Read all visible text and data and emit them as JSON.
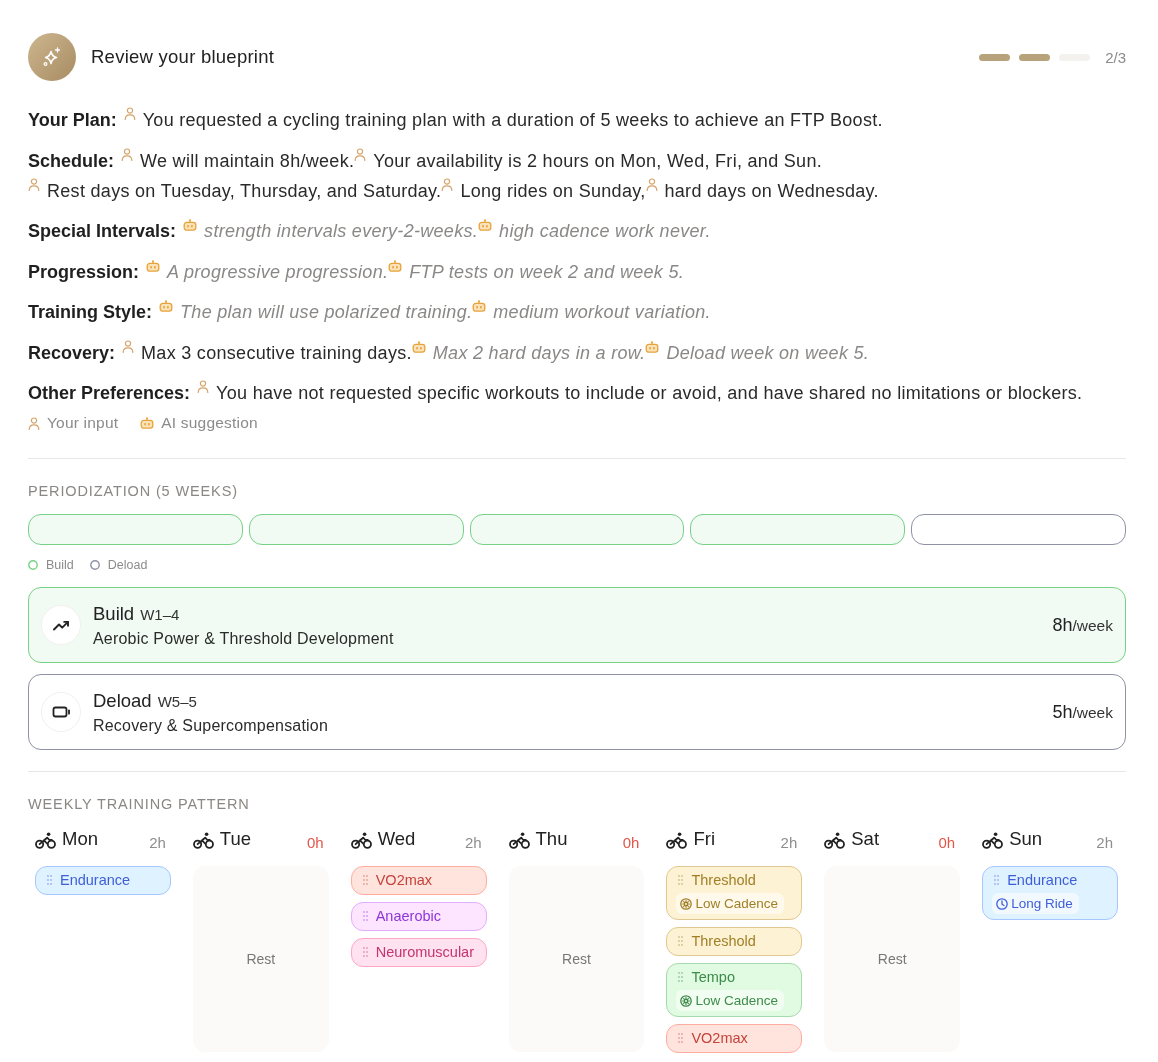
{
  "header": {
    "title": "Review your blueprint",
    "progress": {
      "steps": [
        {
          "done": true
        },
        {
          "done": true
        },
        {
          "done": false
        }
      ],
      "label": "2/3"
    }
  },
  "summary": [
    {
      "label": "Your Plan:",
      "segments": [
        {
          "kind": "user",
          "text": "You requested a cycling training plan with a duration of 5 weeks to achieve an FTP Boost."
        }
      ]
    },
    {
      "label": "Schedule:",
      "segments": [
        {
          "kind": "user",
          "text": "We will maintain 8h/week."
        },
        {
          "kind": "user",
          "text": "Your availability is 2 hours on Mon, Wed, Fri, and Sun."
        },
        {
          "kind": "user",
          "text": "Rest days on Tuesday, Thursday, and Saturday."
        },
        {
          "kind": "user",
          "text": "Long rides on Sunday,"
        },
        {
          "kind": "user",
          "text": "hard days on Wednesday."
        }
      ]
    },
    {
      "label": "Special Intervals:",
      "segments": [
        {
          "kind": "ai",
          "text": "strength intervals every-2-weeks."
        },
        {
          "kind": "ai",
          "text": "high cadence work never."
        }
      ]
    },
    {
      "label": "Progression:",
      "segments": [
        {
          "kind": "ai",
          "text": "A progressive progression."
        },
        {
          "kind": "ai",
          "text": "FTP tests on week 2 and week 5."
        }
      ]
    },
    {
      "label": "Training Style:",
      "segments": [
        {
          "kind": "ai",
          "text": "The plan will use polarized training."
        },
        {
          "kind": "ai",
          "text": "medium workout variation."
        }
      ]
    },
    {
      "label": "Recovery:",
      "segments": [
        {
          "kind": "user",
          "text": "Max 3 consecutive training days."
        },
        {
          "kind": "ai",
          "text": "Max 2 hard days in a row."
        },
        {
          "kind": "ai",
          "text": "Deload week on week 5."
        }
      ]
    },
    {
      "label": "Other Preferences:",
      "segments": [
        {
          "kind": "user",
          "text": "You have not requested specific workouts to include or avoid, and have shared no limitations or blockers."
        }
      ]
    }
  ],
  "legend": [
    {
      "kind": "user",
      "label": "Your input"
    },
    {
      "kind": "ai",
      "label": "AI suggestion"
    }
  ],
  "periodization": {
    "title": "PERIODIZATION (5 WEEKS)",
    "weeks": [
      {
        "kind": "build"
      },
      {
        "kind": "build"
      },
      {
        "kind": "build"
      },
      {
        "kind": "build"
      },
      {
        "kind": "deload"
      }
    ],
    "legend": [
      {
        "kind": "build",
        "label": "Build"
      },
      {
        "kind": "deload",
        "label": "Deload"
      }
    ],
    "phases": [
      {
        "kind": "build",
        "name": "Build",
        "weeks": "W1–4",
        "focus": "Aerobic Power & Threshold Development",
        "hours": "8h",
        "unit": "/week"
      },
      {
        "kind": "deload",
        "name": "Deload",
        "weeks": "W5–5",
        "focus": "Recovery & Supercompensation",
        "hours": "5h",
        "unit": "/week"
      }
    ]
  },
  "weekly_pattern": {
    "title": "WEEKLY TRAINING PATTERN",
    "days": [
      {
        "name": "Mon",
        "hours": "2h",
        "rest": false,
        "workouts": [
          {
            "name": "Endurance",
            "color": "#3f5fd8"
          }
        ]
      },
      {
        "name": "Tue",
        "hours": "0h",
        "rest": true,
        "rest_label": "Rest"
      },
      {
        "name": "Wed",
        "hours": "2h",
        "rest": false,
        "workouts": [
          {
            "name": "VO2max",
            "color": "#c4423a"
          },
          {
            "name": "Anaerobic",
            "color": "#8d36d8"
          },
          {
            "name": "Neuromuscular",
            "color": "#c2356f"
          }
        ]
      },
      {
        "name": "Thu",
        "hours": "0h",
        "rest": true,
        "rest_label": "Rest"
      },
      {
        "name": "Fri",
        "hours": "2h",
        "rest": false,
        "workouts": [
          {
            "name": "Threshold",
            "color": "#a07f26",
            "tag": {
              "kind": "cadence",
              "label": "Low Cadence"
            }
          },
          {
            "name": "Threshold",
            "color": "#a07f26"
          },
          {
            "name": "Tempo",
            "color": "#3d8b4a",
            "tag": {
              "kind": "cadence",
              "label": "Low Cadence"
            }
          },
          {
            "name": "VO2max",
            "color": "#c4423a"
          }
        ]
      },
      {
        "name": "Sat",
        "hours": "0h",
        "rest": true,
        "rest_label": "Rest"
      },
      {
        "name": "Sun",
        "hours": "2h",
        "rest": false,
        "workouts": [
          {
            "name": "Endurance",
            "color": "#3f5fd8",
            "tag": {
              "kind": "duration",
              "label": "Long Ride"
            }
          }
        ]
      }
    ]
  }
}
